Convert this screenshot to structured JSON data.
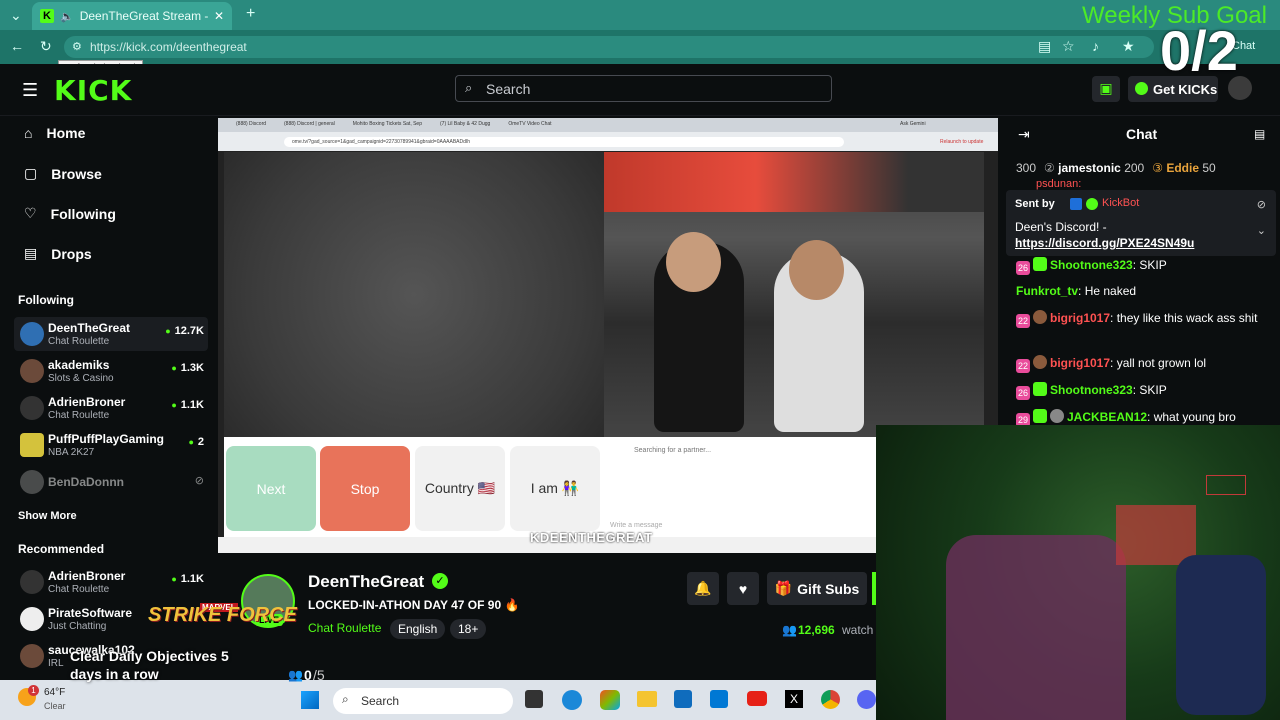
{
  "browser": {
    "tab_title": "DeenTheGreat Stream - Watch",
    "url": "https://kick.com/deenthegreat",
    "tooltip": "Refresh (Ctrl+R)",
    "chat_label": "Chat"
  },
  "header": {
    "logo": "KICK",
    "search_placeholder": "Search",
    "get_kicks": "Get KICKs"
  },
  "sidebar": {
    "nav": [
      {
        "label": "Home",
        "icon": "home-icon"
      },
      {
        "label": "Browse",
        "icon": "browse-icon"
      },
      {
        "label": "Following",
        "icon": "heart-icon"
      },
      {
        "label": "Drops",
        "icon": "gift-icon"
      }
    ],
    "following_title": "Following",
    "following": [
      {
        "name": "DeenTheGreat",
        "category": "Chat Roulette",
        "viewers": "12.7K"
      },
      {
        "name": "akademiks",
        "category": "Slots & Casino",
        "viewers": "1.3K"
      },
      {
        "name": "AdrienBroner",
        "category": "Chat Roulette",
        "viewers": "1.1K"
      },
      {
        "name": "PuffPuffPlayGaming",
        "category": "NBA 2K27",
        "viewers": "2"
      },
      {
        "name": "BenDaDonnn",
        "category": "",
        "viewers": ""
      }
    ],
    "show_more": "Show More",
    "recommended_title": "Recommended",
    "recommended": [
      {
        "name": "AdrienBroner",
        "category": "Chat Roulette",
        "viewers": "1.1K"
      },
      {
        "name": "PirateSoftware",
        "category": "Just Chatting",
        "viewers": ""
      },
      {
        "name": "saucewalka102",
        "category": "IRL",
        "viewers": ""
      }
    ]
  },
  "stream": {
    "buttons": {
      "next": "Next",
      "stop": "Stop",
      "country": "Country 🇺🇸",
      "iam": "I am 👫"
    },
    "searching": "Searching for a partner...",
    "type_message": "Write a message",
    "watermark": "KDEENTHEGREAT",
    "inner_tabs": [
      "(888) Discord",
      "(888) Discord | general",
      "Mohito Boxing Tickets Sat, Sep",
      "(7) Lil Baby & 42 Dugg",
      "OmeTV Video Chat"
    ],
    "inner_url": "ome.tv/?gad_source=1&gad_campaignid=22730789941&gbraid=0AAAABADdIh",
    "ask_gemini": "Ask Gemini",
    "relaunch": "Relaunch to update"
  },
  "channel": {
    "name": "DeenTheGreat",
    "title": "LOCKED-IN-ATHON DAY 47 OF 90 🔥",
    "category": "Chat Roulette",
    "tags": [
      "English",
      "18+"
    ],
    "live_badge": "LIVE",
    "viewers": "12,696",
    "viewers_suffix": "watch",
    "gift_subs": "Gift Subs"
  },
  "chat": {
    "title": "Chat",
    "gifters": [
      {
        "name": "300",
        "value": ""
      },
      {
        "name": "jamestonic",
        "value": "200"
      },
      {
        "name": "Eddie",
        "value": "50"
      }
    ],
    "pinned": {
      "sent_by": "Sent by",
      "bot": "KickBot",
      "text": "Deen's Discord! -",
      "link": "https://discord.gg/PXE24SN49u",
      "partial_user": "psdunan:"
    },
    "messages": [
      {
        "badge": "26",
        "user": "Shootnone323",
        "text": "SKIP",
        "color": "#53fc18"
      },
      {
        "badge": "",
        "user": "Funkrot_tv",
        "text": "He naked",
        "color": "#53fc18"
      },
      {
        "badge": "22",
        "user": "bigrig1017",
        "text": "they like this wack ass shit",
        "color": "#ff5252"
      },
      {
        "badge": "22",
        "user": "bigrig1017",
        "text": "yall not grown lol",
        "color": "#ff5252"
      },
      {
        "badge": "26",
        "user": "Shootnone323",
        "text": "SKIP",
        "color": "#53fc18"
      },
      {
        "badge": "29",
        "user": "JACKBEAN12",
        "text": "what young bro",
        "color": "#53fc18"
      }
    ]
  },
  "overlays": {
    "sub_goal": "Weekly Sub Goal",
    "sub_count": "0/2",
    "objective": "Clear Daily Objectives 5 days in a row",
    "objective_count": "0",
    "objective_total": "/5",
    "strike_force": "STRIKE FORCE",
    "marvel": "MARVEL"
  },
  "windows_taskbar": {
    "weather_temp": "64°F",
    "weather_desc": "Clear",
    "search": "Search",
    "notification": "1"
  },
  "colors": {
    "accent": "#53fc18",
    "stop": "#e8735a",
    "next": "#a8dcc0"
  }
}
